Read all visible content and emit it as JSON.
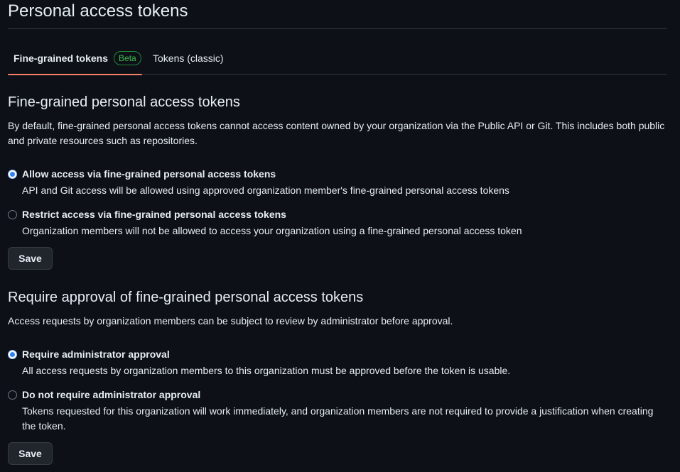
{
  "page": {
    "title": "Personal access tokens"
  },
  "tabs": [
    {
      "label": "Fine-grained tokens",
      "badge": "Beta",
      "active": true
    },
    {
      "label": "Tokens (classic)",
      "active": false
    }
  ],
  "fine_grained": {
    "heading": "Fine-grained personal access tokens",
    "description": "By default, fine-grained personal access tokens cannot access content owned by your organization via the Public API or Git. This includes both public and private resources such as repositories.",
    "options": [
      {
        "label": "Allow access via fine-grained personal access tokens",
        "note": "API and Git access will be allowed using approved organization member's fine-grained personal access tokens",
        "checked": true
      },
      {
        "label": "Restrict access via fine-grained personal access tokens",
        "note": "Organization members will not be allowed to access your organization using a fine-grained personal access token",
        "checked": false
      }
    ],
    "save_label": "Save"
  },
  "approval": {
    "heading": "Require approval of fine-grained personal access tokens",
    "description": "Access requests by organization members can be subject to review by administrator before approval.",
    "options": [
      {
        "label": "Require administrator approval",
        "note": "All access requests by organization members to this organization must be approved before the token is usable.",
        "checked": true
      },
      {
        "label": "Do not require administrator approval",
        "note": "Tokens requested for this organization will work immediately, and organization members are not required to provide a justification when creating the token.",
        "checked": false
      }
    ],
    "save_label": "Save"
  },
  "colors": {
    "background": "#0d1117",
    "tab_underline": "#f78166",
    "beta_badge": "#3fb950",
    "radio_checked": "#2f81f7"
  }
}
